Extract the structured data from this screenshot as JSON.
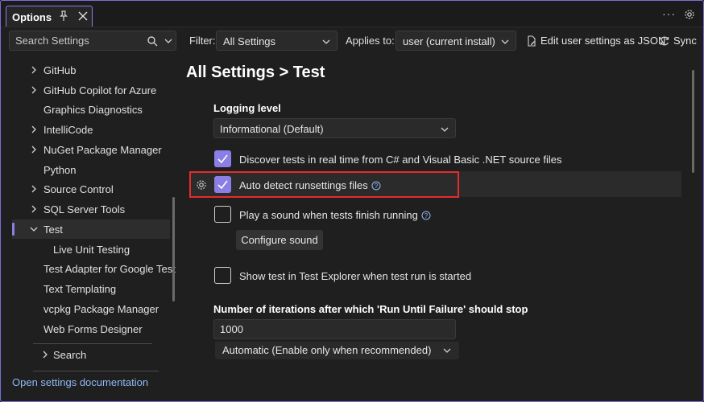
{
  "window": {
    "tab_title": "Options"
  },
  "toolbar": {
    "search_placeholder": "Search Settings",
    "filter_label": "Filter:",
    "filter_value": "All Settings",
    "applies_label": "Applies to:",
    "applies_value": "user (current install)",
    "edit_json": "Edit user settings as JSON",
    "sync": "Sync"
  },
  "sidebar": {
    "items": [
      {
        "label": "GitHub",
        "expandable": true
      },
      {
        "label": "GitHub Copilot for Azure",
        "expandable": true
      },
      {
        "label": "Graphics Diagnostics",
        "expandable": false
      },
      {
        "label": "IntelliCode",
        "expandable": true
      },
      {
        "label": "NuGet Package Manager",
        "expandable": true
      },
      {
        "label": "Python",
        "expandable": false
      },
      {
        "label": "Source Control",
        "expandable": true
      },
      {
        "label": "SQL Server Tools",
        "expandable": true
      },
      {
        "label": "Test",
        "expandable": true,
        "expanded": true,
        "selected": true
      },
      {
        "label": "Live Unit Testing",
        "expandable": false,
        "child": true
      },
      {
        "label": "Test Adapter for Google Test",
        "expandable": false
      },
      {
        "label": "Text Templating",
        "expandable": false
      },
      {
        "label": "vcpkg Package Manager",
        "expandable": false
      },
      {
        "label": "Web Forms Designer",
        "expandable": false
      }
    ],
    "search_item": "Search",
    "doc_link": "Open settings documentation"
  },
  "main": {
    "breadcrumb": "All Settings > Test",
    "logging_label": "Logging level",
    "logging_value": "Informational (Default)",
    "discover_label": "Discover tests in real time from C# and Visual Basic .NET source files",
    "discover_checked": true,
    "auto_detect_label": "Auto detect runsettings files",
    "auto_detect_checked": true,
    "play_sound_label": "Play a sound when tests finish running",
    "play_sound_checked": false,
    "configure_sound": "Configure sound",
    "show_test_label": "Show test in Test Explorer when test run is started",
    "show_test_checked": false,
    "iterations_label": "Number of iterations after which 'Run Until Failure' should stop",
    "iterations_value": "1000",
    "automatic_value": "Automatic (Enable only when recommended)"
  },
  "colors": {
    "accent": "#8b7fe6",
    "highlight_border": "#e52b2b",
    "link": "#8fb8f5"
  }
}
